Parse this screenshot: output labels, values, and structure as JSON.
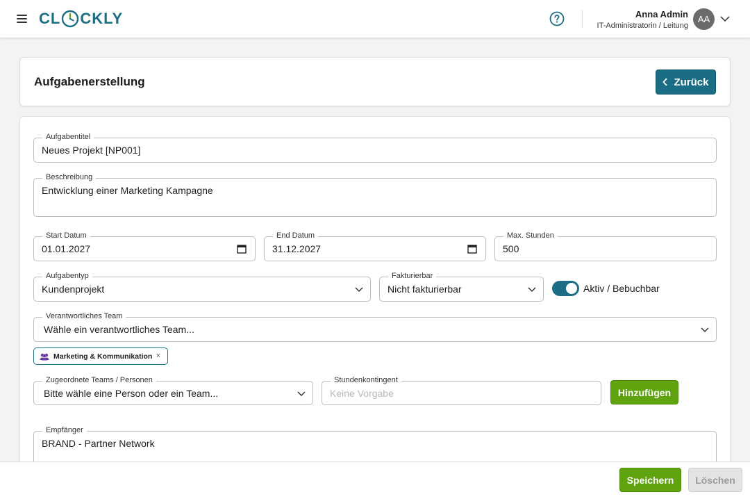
{
  "app": {
    "logo_text_left": "CL",
    "logo_text_right": "CKLY",
    "brand_color": "#1b6d86"
  },
  "header": {
    "menu_icon": "hamburger-menu-icon",
    "help_icon": "help-circle-icon",
    "user": {
      "name": "Anna Admin",
      "role": "IT-Administratorin / Leitung",
      "initials": "AA"
    }
  },
  "page": {
    "title": "Aufgabenerstellung",
    "back_label": "Zurück"
  },
  "form": {
    "title": {
      "label": "Aufgabentitel",
      "value": "Neues Projekt [NP001]"
    },
    "description": {
      "label": "Beschreibung",
      "value": "Entwicklung einer Marketing Kampagne"
    },
    "start_date": {
      "label": "Start Datum",
      "value": "01.01.2027"
    },
    "end_date": {
      "label": "End Datum",
      "value": "31.12.2027"
    },
    "max_hours": {
      "label": "Max. Stunden",
      "value": "500"
    },
    "task_type": {
      "label": "Aufgabentyp",
      "value": "Kundenprojekt"
    },
    "billable": {
      "label": "Fakturierbar",
      "value": "Nicht fakturierbar"
    },
    "active": {
      "label": "Aktiv / Bebuchbar",
      "on": true
    },
    "responsible_team": {
      "label": "Verantwortliches Team",
      "value": "Wähle ein verantwortliches Team...",
      "selected_chip": "Marketing & Kommunikation",
      "chip_remove": "×"
    },
    "assigned": {
      "label": "Zugeordnete Teams / Personen",
      "value": "Bitte wähle eine Person oder ein Team..."
    },
    "hour_quota": {
      "label": "Stundenkontingent",
      "placeholder": "Keine Vorgabe"
    },
    "add_label": "Hinzufügen",
    "recipient": {
      "label": "Empfänger",
      "value": "BRAND - Partner Network"
    }
  },
  "footer": {
    "save_label": "Speichern",
    "delete_label": "Löschen"
  },
  "colors": {
    "accent": "#1b6d86",
    "success": "#5fa30f",
    "disabled": "#e3e3e3",
    "team_icon": "#6b3fa0"
  }
}
